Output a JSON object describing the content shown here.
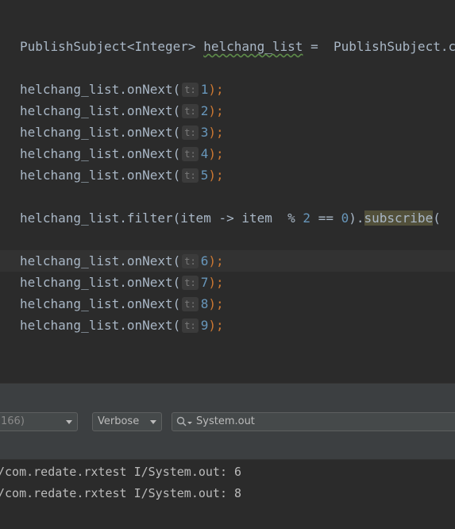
{
  "editor": {
    "declaration": {
      "type": "PublishSubject<Integer>",
      "variable": "helchang_list",
      "assign": " =  ",
      "rhs": "PublishSubject.create();"
    },
    "call_prefix": "helchang_list.onNext(",
    "param_hint": "t:",
    "semicolon": ");",
    "first_batch": [
      "1",
      "2",
      "3",
      "4",
      "5"
    ],
    "filter_line": {
      "prefix": "helchang_list.filter(item -> item  % ",
      "mod": "2",
      "op": " == ",
      "zero": "0",
      "close": ").",
      "subscribe": "subscribe",
      "tail": "("
    },
    "second_batch": [
      "6",
      "7",
      "8",
      "9"
    ]
  },
  "logcat": {
    "device_value": "166)",
    "level_value": "Verbose",
    "search_value": "System.out",
    "lines": [
      "/com.redate.rxtest I/System.out: 6",
      "/com.redate.rxtest I/System.out: 8"
    ]
  }
}
